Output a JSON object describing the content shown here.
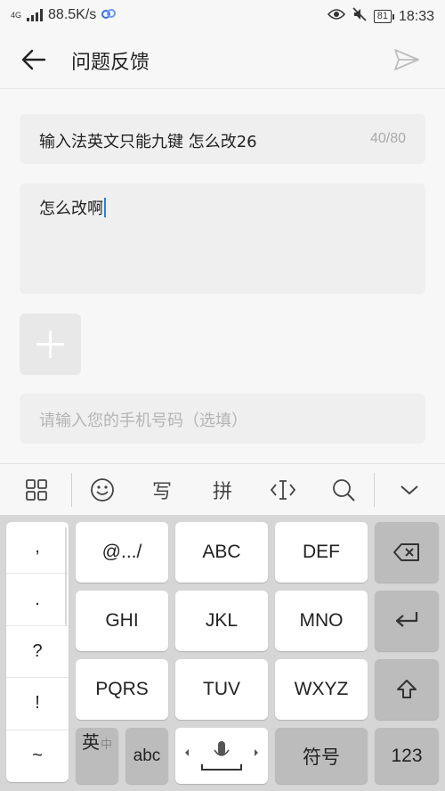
{
  "status": {
    "network_type": "4G",
    "speed": "88.5K/s",
    "battery": "81",
    "time": "18:33"
  },
  "header": {
    "title": "问题反馈"
  },
  "form": {
    "subject_text": "输入法英文只能九键  怎么改26",
    "subject_count": "40/80",
    "description_text": "怎么改啊",
    "phone_placeholder": "请输入您的手机号码（选填）"
  },
  "keyboard_toolbar": {
    "handwrite": "写",
    "pinyin": "拼"
  },
  "keyboard": {
    "punctuation": [
      ",",
      ".",
      "?",
      "!",
      "~"
    ],
    "keys": {
      "symbols": "@.../",
      "abc_key": "ABC",
      "def_key": "DEF",
      "ghi_key": "GHI",
      "jkl_key": "JKL",
      "mno_key": "MNO",
      "pqrs_key": "PQRS",
      "tuv_key": "TUV",
      "wxyz_key": "WXYZ",
      "lang_main": "英",
      "lang_sub": "中",
      "abc_mode": "abc",
      "symbol_mode": "符号",
      "number_mode": "123"
    }
  }
}
